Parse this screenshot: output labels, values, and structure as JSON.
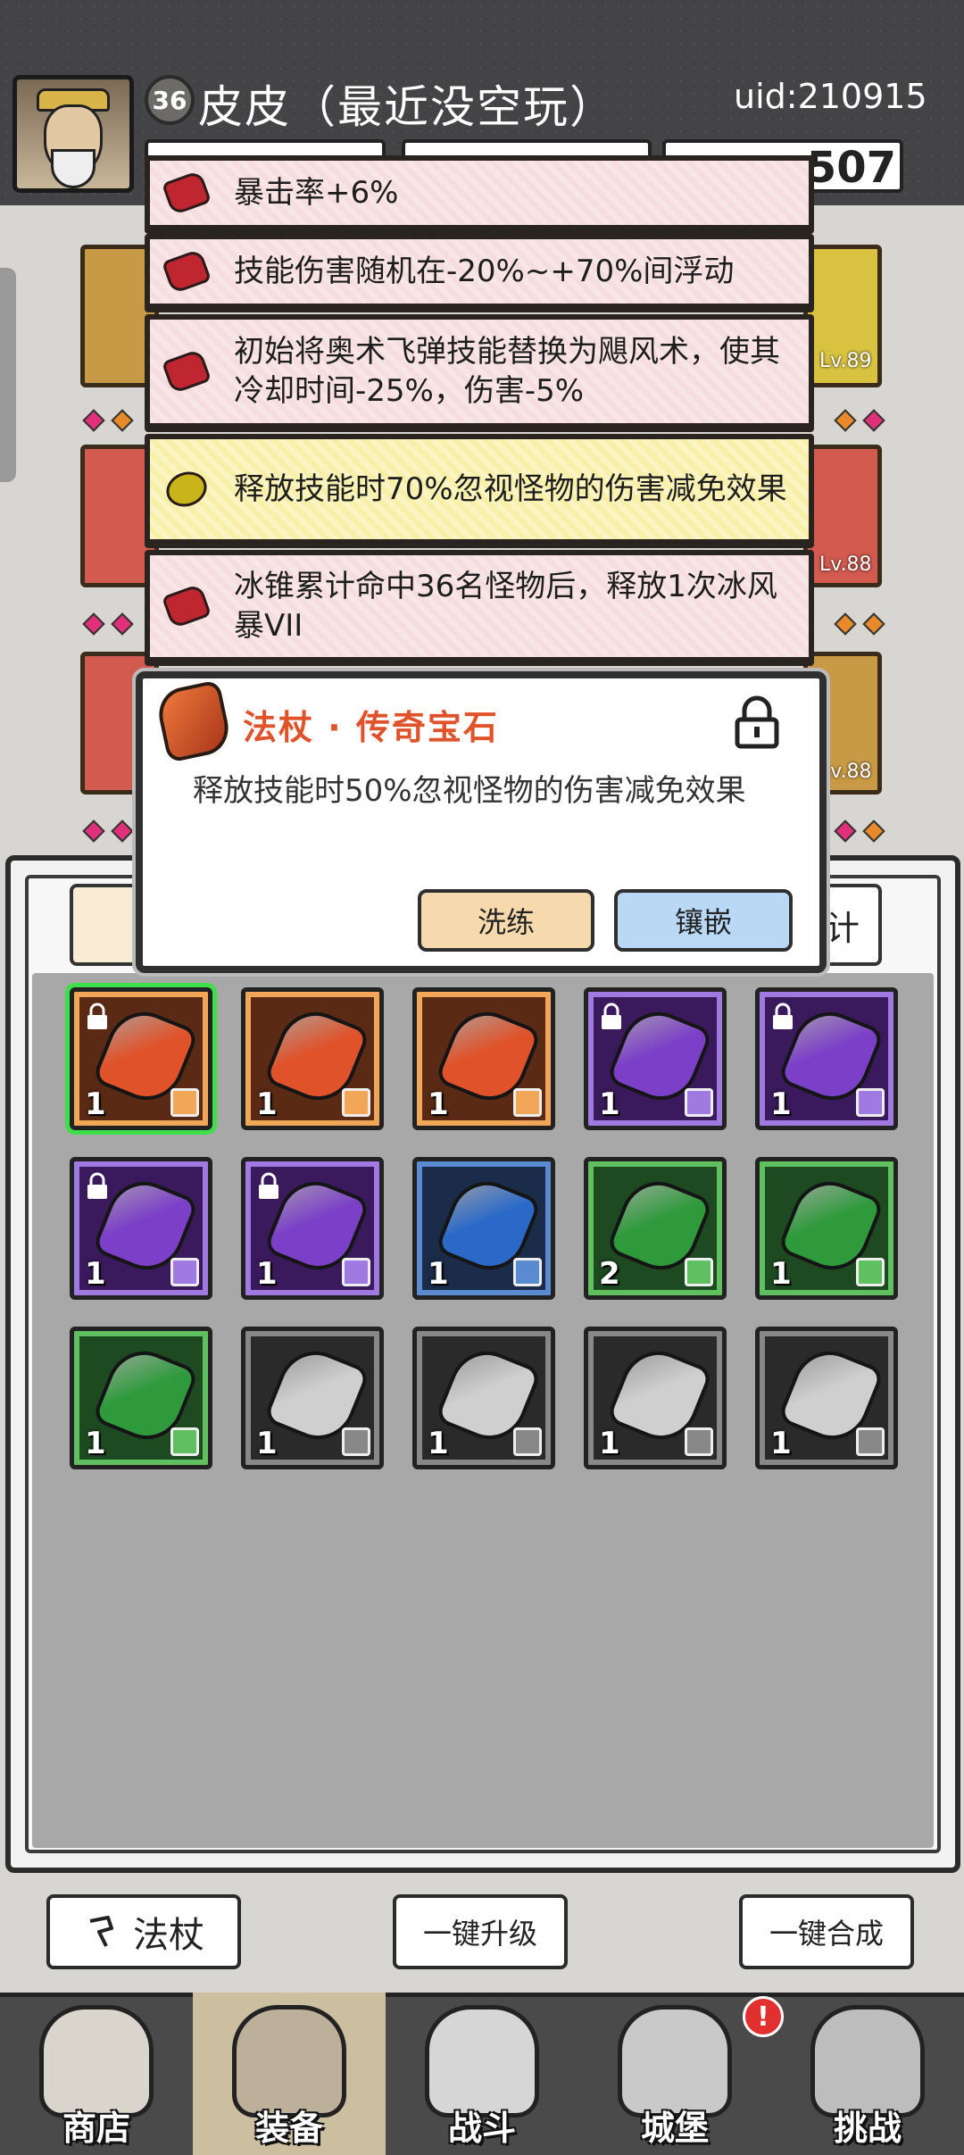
{
  "player": {
    "level": "36",
    "name": "皮皮（最近没空玩）",
    "uid": "uid:210915",
    "resource_value": "507"
  },
  "equipment_levels": [
    "Lv.89",
    "Lv.88",
    "Lv.88"
  ],
  "affixes": [
    {
      "text": "暴击率+6%",
      "color": "red"
    },
    {
      "text": "技能伤害随机在-20%~+70%间浮动",
      "color": "red"
    },
    {
      "text": "初始将奥术飞弹技能替换为飓风术，使其冷却时间-25%，伤害-5%",
      "color": "red"
    },
    {
      "text": "释放技能时70%忽视怪物的伤害减免效果",
      "color": "yellow"
    },
    {
      "text": "冰锥累计命中36名怪物后，释放1次冰风暴VII",
      "color": "red"
    }
  ],
  "popup": {
    "title": "法杖 · 传奇宝石",
    "description": "释放技能时50%忽视怪物的伤害减免效果",
    "wash_label": "洗练",
    "embed_label": "镶嵌"
  },
  "inventory": [
    {
      "color": "orange",
      "count": "1",
      "locked": true
    },
    {
      "color": "orange",
      "count": "1",
      "locked": false
    },
    {
      "color": "orange",
      "count": "1",
      "locked": false
    },
    {
      "color": "purple",
      "count": "1",
      "locked": true
    },
    {
      "color": "purple",
      "count": "1",
      "locked": true
    },
    {
      "color": "purple",
      "count": "1",
      "locked": true
    },
    {
      "color": "purple",
      "count": "1",
      "locked": true
    },
    {
      "color": "blue",
      "count": "1",
      "locked": false
    },
    {
      "color": "green",
      "count": "2",
      "locked": false
    },
    {
      "color": "green",
      "count": "1",
      "locked": false
    },
    {
      "color": "green",
      "count": "1",
      "locked": false
    },
    {
      "color": "white",
      "count": "1",
      "locked": false
    },
    {
      "color": "white",
      "count": "1",
      "locked": false
    },
    {
      "color": "white",
      "count": "1",
      "locked": false
    },
    {
      "color": "white",
      "count": "1",
      "locked": false
    }
  ],
  "filter_right_label": "计",
  "actions": {
    "wand_label": "法杖",
    "upgrade_label": "一键升级",
    "merge_label": "一键合成"
  },
  "nav": [
    {
      "label": "商店",
      "icon": "shop-icon"
    },
    {
      "label": "装备",
      "icon": "backpack-icon"
    },
    {
      "label": "战斗",
      "icon": "crossed-swords-icon"
    },
    {
      "label": "城堡",
      "icon": "castle-icon"
    },
    {
      "label": "挑战",
      "icon": "shield-icon"
    }
  ],
  "notification": "!",
  "colors": {
    "orange": "#e0522a",
    "purple": "#7b3fc8",
    "blue": "#2a69c8",
    "green": "#2f9a3c",
    "white": "#cfcfcf",
    "affix_red": "#f6dede",
    "affix_yellow": "#f8f0a8"
  }
}
